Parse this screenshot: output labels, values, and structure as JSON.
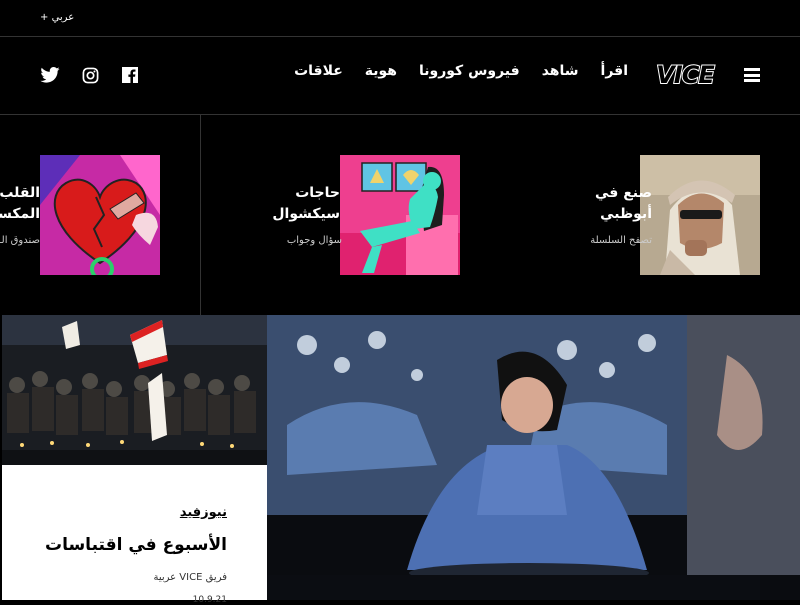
{
  "topbar": {
    "language_label": "+ عربي"
  },
  "nav": {
    "links": [
      "اقرأ",
      "شاهد",
      "فيروس كورونا",
      "هوية",
      "علاقات"
    ],
    "logo_text": "VICE",
    "social": [
      "twitter-icon",
      "instagram-icon",
      "facebook-icon"
    ]
  },
  "series_cards": [
    {
      "title_line1": "صنع في",
      "title_line2": "أبوظبي",
      "subtitle": "تصفح السلسلة"
    },
    {
      "title_line1": "حاجات",
      "title_line2": "سيكشوال",
      "subtitle": "سؤال وجواب"
    },
    {
      "title_line1": "القلب",
      "title_line2": "المكسور",
      "subtitle": "صندوق الـ"
    }
  ],
  "article": {
    "category": "نيوزفيد",
    "title": "الأسبوع في اقتباسات",
    "byline": "فريق VICE عربية",
    "date": "10.9.21"
  },
  "colors": {
    "background": "#000000",
    "card_background": "#ffffff",
    "accent_pink": "#e0226f"
  }
}
